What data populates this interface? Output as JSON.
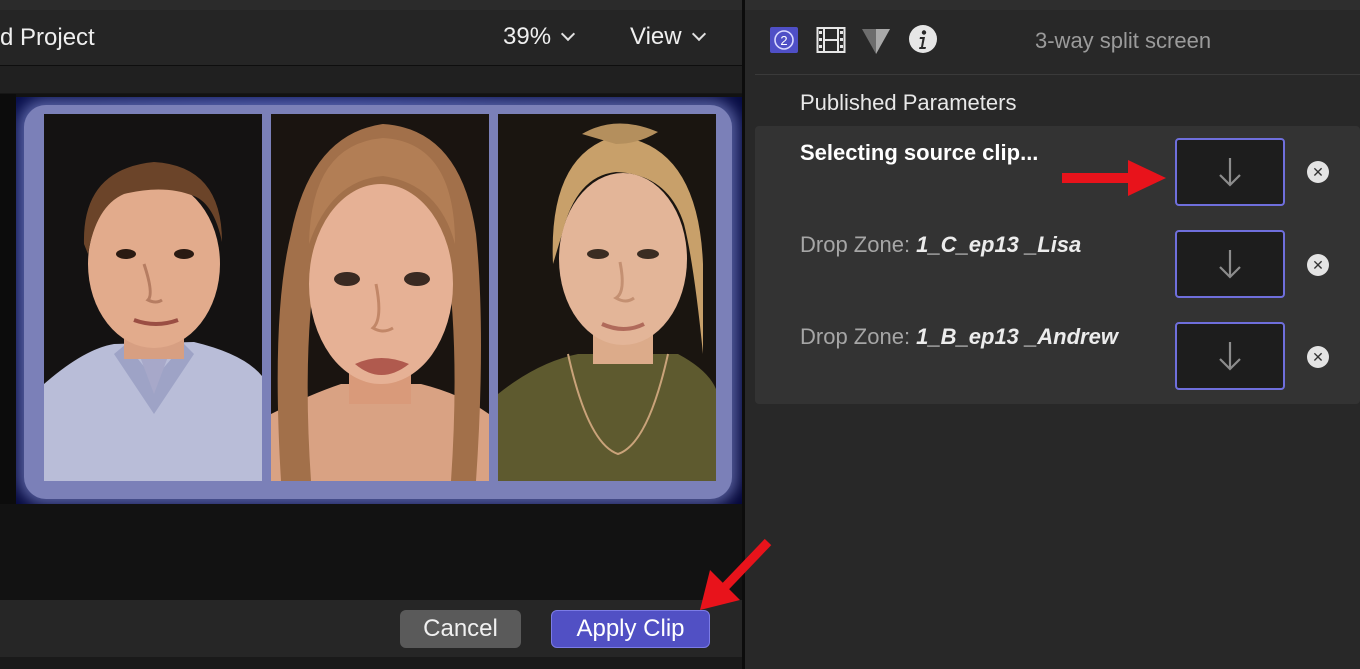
{
  "viewer": {
    "project_title": "d Project",
    "zoom_label": "39%",
    "view_label": "View"
  },
  "dialog": {
    "cancel_label": "Cancel",
    "apply_label": "Apply Clip"
  },
  "inspector": {
    "icons": [
      "generator-badge-icon",
      "film-icon",
      "filter-icon",
      "info-icon"
    ],
    "generator_badge_number": "2",
    "clip_name": "3-way split screen",
    "section_title": "Published Parameters",
    "params": [
      {
        "label": "Selecting source clip...",
        "value": "",
        "state": "selecting"
      },
      {
        "label": "Drop Zone: ",
        "value": "1_C_ep13 _Lisa",
        "state": "assigned"
      },
      {
        "label": "Drop Zone: ",
        "value": "1_B_ep13 _Andrew",
        "state": "assigned"
      }
    ]
  },
  "colors": {
    "accent": "#5150c4",
    "annotation_arrow": "#e8131b",
    "drop_well_border": "#6f6fdc"
  }
}
